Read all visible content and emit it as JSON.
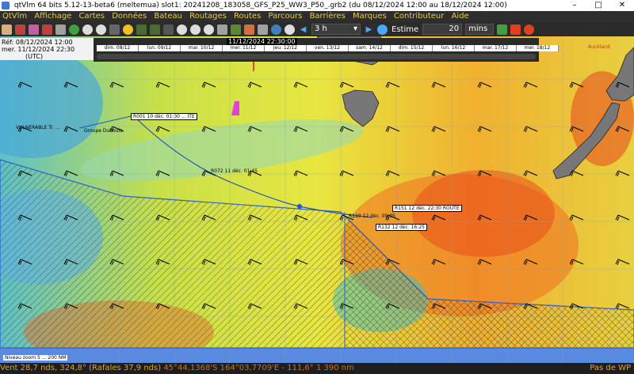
{
  "window": {
    "title": "qtVlm 64 bits 5.12-13-beta6 (meltemua) slot1: 20241208_183058_GFS_P25_WW3_P50_.grb2 (du 08/12/2024 12:00 au 18/12/2024 12:00)",
    "controls": [
      "–",
      "□",
      "✕"
    ]
  },
  "menu": [
    "QtVlm",
    "Affichage",
    "Cartes",
    "Données",
    "Bateau",
    "Routages",
    "Routes",
    "Parcours",
    "Barrières",
    "Marques",
    "Contributeur",
    "Aide"
  ],
  "toolbar": {
    "step": "3 h",
    "estimate_label": "Estime",
    "estimate_value": "20",
    "unit": "mins"
  },
  "time_panel": {
    "ref": "Réf: 08/12/2024 12:00",
    "current": "mer. 11/12/2024 22:30",
    "tz": "(UTC)"
  },
  "timeline": {
    "current_label": "11/12/2024 22:30:00",
    "days": [
      "dim. 08/12",
      "lun. 09/12",
      "mar. 10/12",
      "mer. 11/12",
      "jeu. 12/12",
      "ven. 13/12",
      "sam. 14/12",
      "dim. 15/12",
      "lun. 16/12",
      "mar. 17/12",
      "mer. 18/12"
    ]
  },
  "map_labels": {
    "vulnerable": "VULNERABLE Tr. ...",
    "groupe": "Groupe Dubouis",
    "r001": "R001 10 déc. 01:30 ... ITE",
    "r072": "R072 11 déc. 01:45",
    "r110": "R110 12 déc. 09:05",
    "r132": "R132 12 déc. 16:25",
    "r151": "R151 12 déc. 22:30 ROUTE",
    "auckland": "Auckland",
    "zoom": "Niveau zoom 5 ... 200 NM"
  },
  "status": {
    "wind": "Vent 28,7 nds, 324,8° (Rafales 37,9 nds)",
    "position": "45°44,1368'S 164°03,7709'E - 111,6° 1 390 nm",
    "right": "Pas de WP"
  }
}
